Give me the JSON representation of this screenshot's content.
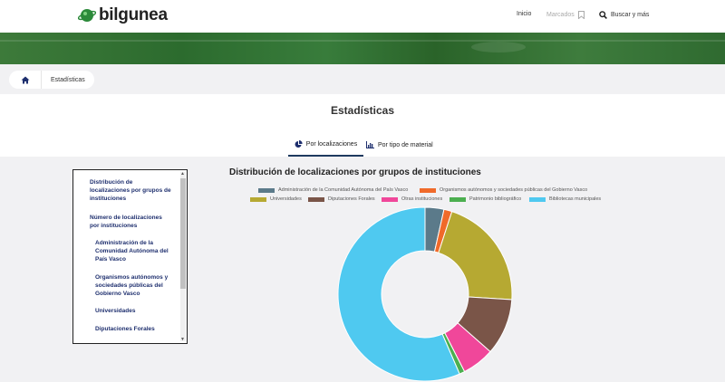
{
  "header": {
    "logo_text": "bilgunea",
    "nav": {
      "inicio": "Inicio",
      "marcados": "Marcados",
      "buscar": "Buscar y más"
    }
  },
  "breadcrumb": {
    "current": "Estadísticas"
  },
  "page": {
    "title": "Estadísticas"
  },
  "tabs": [
    {
      "label": "Por localizaciones",
      "active": true
    },
    {
      "label": "Por tipo de material",
      "active": false
    }
  ],
  "sidebar": {
    "items": [
      {
        "label": "Distribución de localizaciones por grupos de instituciones"
      },
      {
        "label": "Número de localizaciones por instituciones"
      },
      {
        "label": "Administración de la Comunidad Autónoma del País Vasco"
      },
      {
        "label": "Organismos autónomos y sociedades públicas del Gobierno Vasco"
      },
      {
        "label": "Universidades"
      },
      {
        "label": "Diputaciones Forales"
      }
    ]
  },
  "chart_data": {
    "type": "pie",
    "title": "Distribución de localizaciones por grupos de instituciones",
    "legend_position": "top",
    "series": [
      {
        "name": "Administración de la Comunidad Autónoma del País Vasco",
        "value": 3.5,
        "color": "#5b7a8a"
      },
      {
        "name": "Organismos autónomos y sociedades públicas del Gobierno Vasco",
        "value": 1.5,
        "color": "#f06a2a"
      },
      {
        "name": "Universidades",
        "value": 21,
        "color": "#b6a932"
      },
      {
        "name": "Diputaciones Forales",
        "value": 10.5,
        "color": "#7a5548"
      },
      {
        "name": "Otras instituciones",
        "value": 6,
        "color": "#f0479a"
      },
      {
        "name": "Patrimonio bibliográfico",
        "value": 1,
        "color": "#4caf50"
      },
      {
        "name": "Bibliotecas municipales",
        "value": 56.5,
        "color": "#4fc9f0"
      }
    ]
  }
}
